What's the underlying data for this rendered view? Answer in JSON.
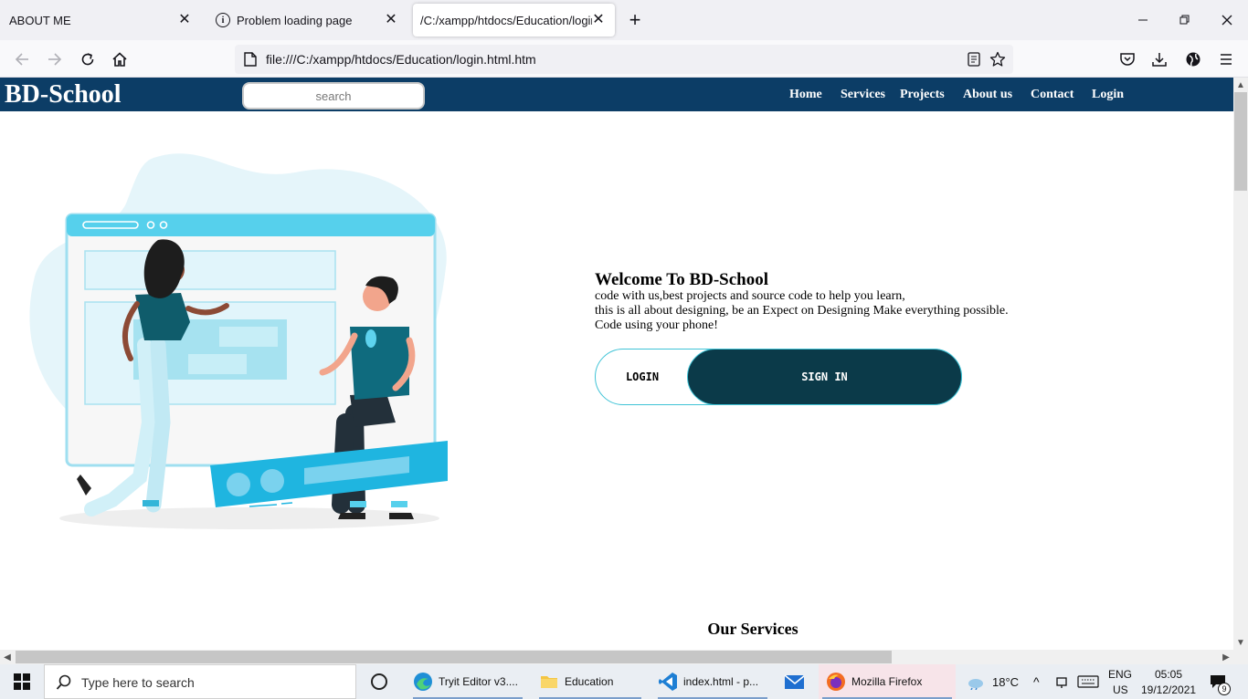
{
  "browser": {
    "tabs": [
      {
        "label": "ABOUT ME"
      },
      {
        "label": "Problem loading page"
      },
      {
        "label": "/C:/xampp/htdocs/Education/login.html.htm"
      }
    ],
    "url": "file:///C:/xampp/htdocs/Education/login.html.htm"
  },
  "site": {
    "brand": "BD-School",
    "search_placeholder": "search",
    "nav": [
      "Home",
      "Services",
      "Projects",
      "About us",
      "Contact",
      "Login"
    ]
  },
  "hero": {
    "title": "Welcome To BD-School",
    "lines": [
      "code with us,best projects and source code to help you learn,",
      "this is all about designing, be an Expect on Designing Make everything possible.",
      "Code using your phone!"
    ],
    "login_label": "LOGIN",
    "signin_label": "SIGN IN"
  },
  "services_title": "Our Services",
  "taskbar": {
    "search_text": "Type here to search",
    "apps": [
      {
        "label": "Tryit Editor v3...."
      },
      {
        "label": "Education"
      },
      {
        "label": "index.html - p..."
      },
      {
        "label": ""
      },
      {
        "label": "Mozilla Firefox"
      }
    ],
    "temperature": "18°C",
    "lang_top": "ENG",
    "lang_bottom": "US",
    "time": "05:05",
    "date": "19/12/2021",
    "notification_count": "9"
  },
  "colors": {
    "site_header": "#0c3d66",
    "signin_button": "#0b3a49",
    "accent_cyan": "#3fc3d6"
  }
}
